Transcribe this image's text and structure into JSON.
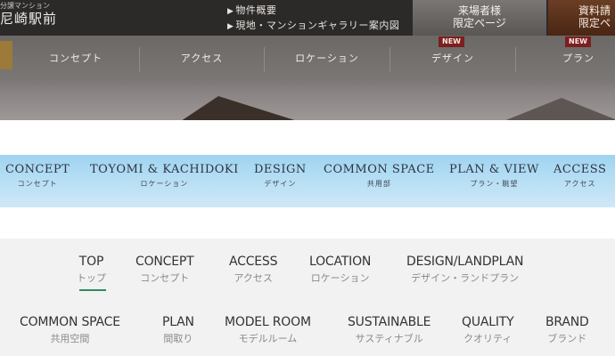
{
  "header": {
    "logo_small": "分譲マンション",
    "logo_main": "尼崎駅前",
    "links": [
      "物件概要",
      "現地・マンションギャラリー案内図"
    ],
    "link_marker": "▶",
    "visitor_page": [
      "来場者様",
      "限定ページ"
    ],
    "document_request": [
      "資料請",
      "限定ペ"
    ],
    "nav": [
      {
        "label": "コンセプト",
        "badge": ""
      },
      {
        "label": "アクセス",
        "badge": ""
      },
      {
        "label": "ロケーション",
        "badge": ""
      },
      {
        "label": "デザイン",
        "badge": "NEW"
      },
      {
        "label": "プラン",
        "badge": "NEW"
      }
    ]
  },
  "blue_nav": [
    {
      "en": "CONCEPT",
      "jp": "コンセプト"
    },
    {
      "en": "TOYOMI & KACHIDOKI",
      "jp": "ロケーション"
    },
    {
      "en": "DESIGN",
      "jp": "デザイン"
    },
    {
      "en": "COMMON SPACE",
      "jp": "共用部"
    },
    {
      "en": "PLAN & VIEW",
      "jp": "プラン・眺望"
    },
    {
      "en": "ACCESS",
      "jp": "アクセス"
    }
  ],
  "grey_nav": {
    "active": "TOP",
    "row1": [
      {
        "en": "TOP",
        "jp": "トップ"
      },
      {
        "en": "CONCEPT",
        "jp": "コンセプト"
      },
      {
        "en": "ACCESS",
        "jp": "アクセス"
      },
      {
        "en": "LOCATION",
        "jp": "ロケーション"
      },
      {
        "en": "DESIGN/LANDPLAN",
        "jp": "デザイン・ランドプラン"
      }
    ],
    "row2": [
      {
        "en": "COMMON SPACE",
        "jp": "共用空間"
      },
      {
        "en": "PLAN",
        "jp": "間取り"
      },
      {
        "en": "MODEL ROOM",
        "jp": "モデルルーム"
      },
      {
        "en": "SUSTAINABLE",
        "jp": "サスティナブル"
      },
      {
        "en": "QUALITY",
        "jp": "クオリティ"
      },
      {
        "en": "BRAND",
        "jp": "ブランド"
      }
    ]
  },
  "colors": {
    "active_underline": "#2f8a5f",
    "new_badge": "#7b1f1f",
    "blue_bar": "#b5def4"
  }
}
